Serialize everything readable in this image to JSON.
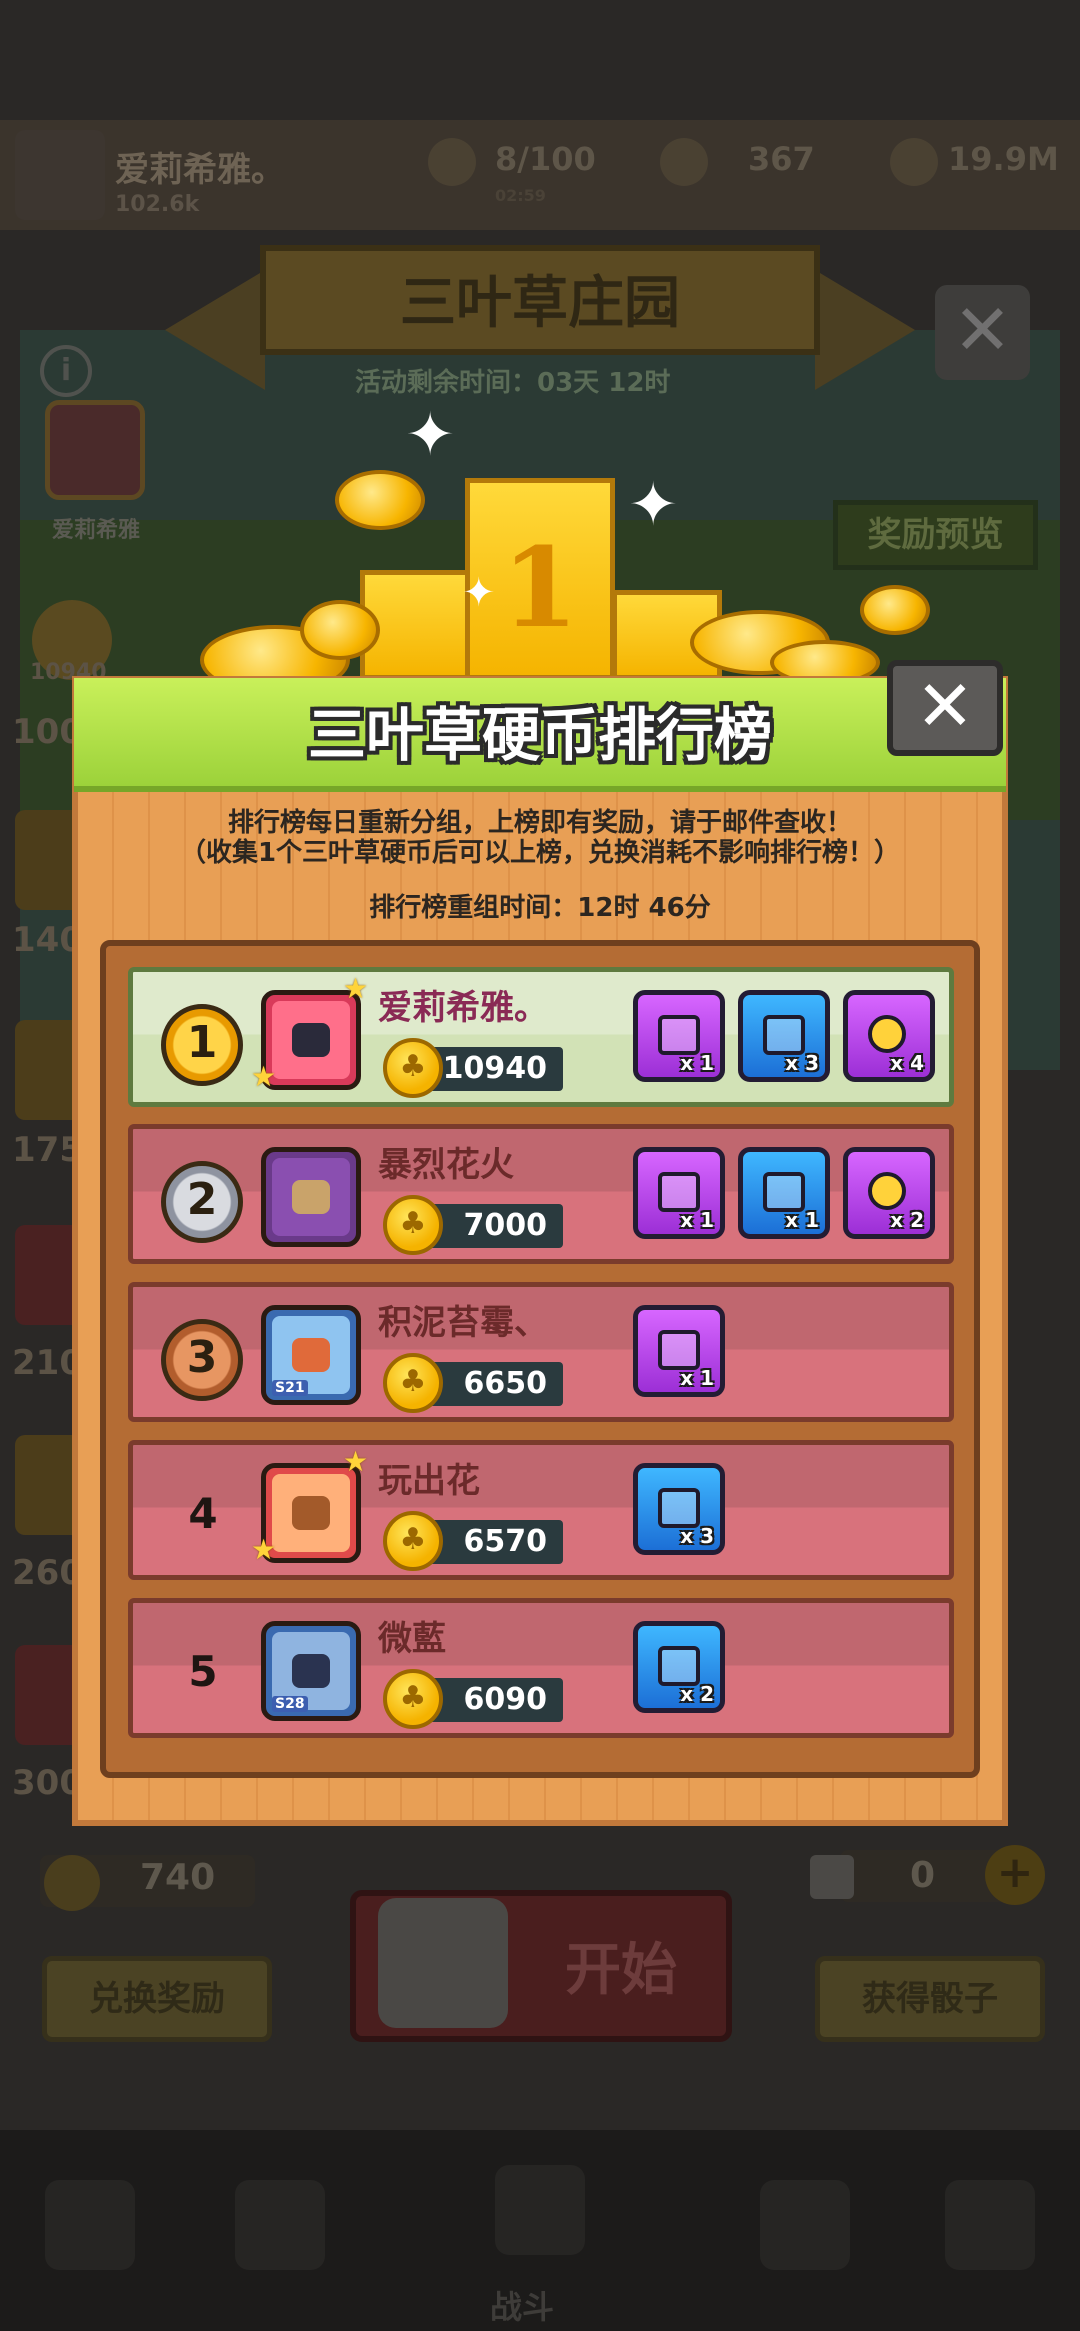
{
  "background": {
    "player_name": "爱莉希雅。",
    "player_sub": "102.6k",
    "stats": [
      "8/100",
      "367",
      "19.9M"
    ],
    "stat_sub": "02:59",
    "event_title": "三叶草庄园",
    "event_timer": "活动剩余时间：03天 12时",
    "mini_name": "爱莉希雅",
    "preview_button": "奖励预览",
    "side_numbers": [
      "10940",
      "100",
      "140",
      "175",
      "210",
      "260",
      "300"
    ],
    "coin_count": "740",
    "dice_count": "0",
    "start_button": "开始",
    "exchange_button": "兑换奖励",
    "get_dice_button": "获得骰子",
    "nav_label": "战斗"
  },
  "podium": {
    "number": "1"
  },
  "leaderboard": {
    "title": "三叶草硬币排行榜",
    "notice_line1": "排行榜每日重新分组，上榜即有奖励，请于邮件查收！",
    "notice_line2": "（收集1个三叶草硬币后可以上榜，兑换消耗不影响排行榜！）",
    "reset_time": "排行榜重组时间：12时 46分",
    "close_icon": "✕",
    "rows": [
      {
        "rank": "1",
        "name": "爱莉希雅。",
        "score": "10940",
        "badge": "",
        "rewards": [
          {
            "type": "purple-gem-chest",
            "qty": "x 1"
          },
          {
            "type": "blue-chest",
            "qty": "x 3"
          },
          {
            "type": "gold-key",
            "qty": "x 4"
          }
        ]
      },
      {
        "rank": "2",
        "name": "暴烈花火",
        "score": "7000",
        "badge": "",
        "rewards": [
          {
            "type": "purple-chest",
            "qty": "x 1"
          },
          {
            "type": "blue-chest",
            "qty": "x 1"
          },
          {
            "type": "gold-key",
            "qty": "x 2"
          }
        ]
      },
      {
        "rank": "3",
        "name": "积泥苔霉、",
        "score": "6650",
        "badge": "S21",
        "rewards": [
          {
            "type": "purple-chest",
            "qty": "x 1"
          }
        ]
      },
      {
        "rank": "4",
        "name": "玩出花",
        "score": "6570",
        "badge": "",
        "rewards": [
          {
            "type": "blue-chest",
            "qty": "x 3"
          }
        ]
      },
      {
        "rank": "5",
        "name": "微藍",
        "score": "6090",
        "badge": "S28",
        "rewards": [
          {
            "type": "blue-chest",
            "qty": "x 2"
          }
        ]
      }
    ]
  },
  "colors": {
    "header_green": "#b6e548",
    "panel_orange": "#e39a4f",
    "first_row": "#dfeacc",
    "other_row": "#d8727c",
    "gold": "#f7b500"
  }
}
